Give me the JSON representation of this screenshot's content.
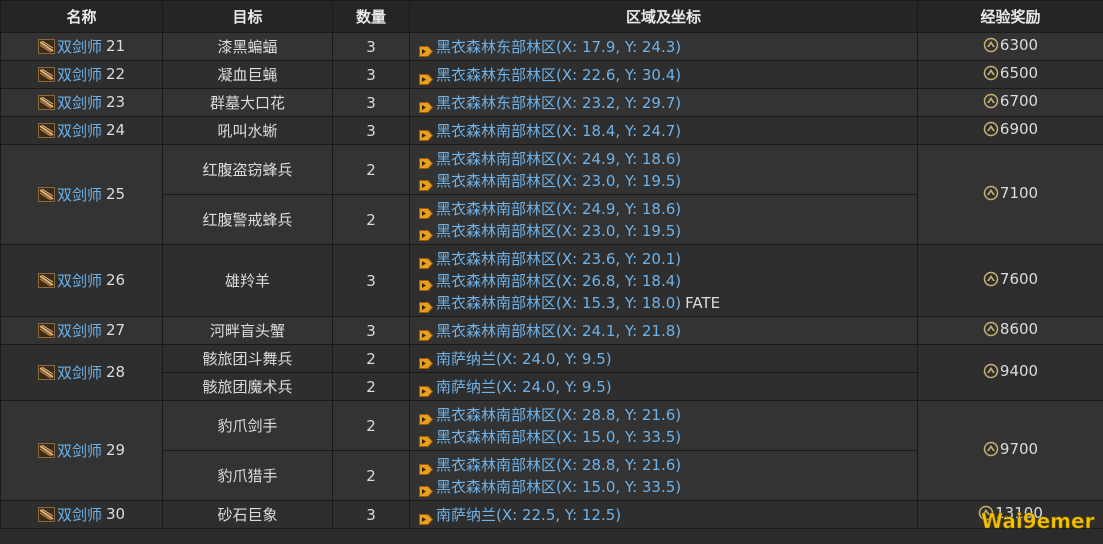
{
  "headers": {
    "name": "名称",
    "target": "目标",
    "qty": "数量",
    "zone": "区域及坐标",
    "exp": "经验奖励"
  },
  "rows": [
    {
      "job": "双剑师",
      "level": "21",
      "exp": "6300",
      "targets": [
        {
          "name": "漆黑蝙蝠",
          "qty": "3",
          "locs": [
            {
              "zone": "黑衣森林东部林区",
              "coord": "(X: 17.9, Y: 24.3)"
            }
          ]
        }
      ]
    },
    {
      "job": "双剑师",
      "level": "22",
      "exp": "6500",
      "targets": [
        {
          "name": "凝血巨蝇",
          "qty": "3",
          "locs": [
            {
              "zone": "黑衣森林东部林区",
              "coord": "(X: 22.6, Y: 30.4)"
            }
          ]
        }
      ]
    },
    {
      "job": "双剑师",
      "level": "23",
      "exp": "6700",
      "targets": [
        {
          "name": "群墓大口花",
          "qty": "3",
          "locs": [
            {
              "zone": "黑衣森林东部林区",
              "coord": "(X: 23.2, Y: 29.7)"
            }
          ]
        }
      ]
    },
    {
      "job": "双剑师",
      "level": "24",
      "exp": "6900",
      "targets": [
        {
          "name": "吼叫水蜥",
          "qty": "3",
          "locs": [
            {
              "zone": "黑衣森林南部林区",
              "coord": "(X: 18.4, Y: 24.7)"
            }
          ]
        }
      ]
    },
    {
      "job": "双剑师",
      "level": "25",
      "exp": "7100",
      "targets": [
        {
          "name": "红腹盗窃蜂兵",
          "qty": "2",
          "locs": [
            {
              "zone": "黑衣森林南部林区",
              "coord": "(X: 24.9, Y: 18.6)"
            },
            {
              "zone": "黑衣森林南部林区",
              "coord": "(X: 23.0, Y: 19.5)"
            }
          ]
        },
        {
          "name": "红腹警戒蜂兵",
          "qty": "2",
          "locs": [
            {
              "zone": "黑衣森林南部林区",
              "coord": "(X: 24.9, Y: 18.6)"
            },
            {
              "zone": "黑衣森林南部林区",
              "coord": "(X: 23.0, Y: 19.5)"
            }
          ]
        }
      ]
    },
    {
      "job": "双剑师",
      "level": "26",
      "exp": "7600",
      "targets": [
        {
          "name": "雄羚羊",
          "qty": "3",
          "locs": [
            {
              "zone": "黑衣森林南部林区",
              "coord": "(X: 23.6, Y: 20.1)"
            },
            {
              "zone": "黑衣森林南部林区",
              "coord": "(X: 26.8, Y: 18.4)"
            },
            {
              "zone": "黑衣森林南部林区",
              "coord": "(X: 15.3, Y: 18.0)",
              "extra": "FATE"
            }
          ]
        }
      ]
    },
    {
      "job": "双剑师",
      "level": "27",
      "exp": "8600",
      "targets": [
        {
          "name": "河畔盲头蟹",
          "qty": "3",
          "locs": [
            {
              "zone": "黑衣森林南部林区",
              "coord": "(X: 24.1, Y: 21.8)"
            }
          ]
        }
      ]
    },
    {
      "job": "双剑师",
      "level": "28",
      "exp": "9400",
      "targets": [
        {
          "name": "骸旅团斗舞兵",
          "qty": "2",
          "locs": [
            {
              "zone": "南萨纳兰",
              "coord": "(X: 24.0, Y: 9.5)"
            }
          ]
        },
        {
          "name": "骸旅团魔术兵",
          "qty": "2",
          "locs": [
            {
              "zone": "南萨纳兰",
              "coord": "(X: 24.0, Y: 9.5)"
            }
          ]
        }
      ]
    },
    {
      "job": "双剑师",
      "level": "29",
      "exp": "9700",
      "targets": [
        {
          "name": "豹爪剑手",
          "qty": "2",
          "locs": [
            {
              "zone": "黑衣森林南部林区",
              "coord": "(X: 28.8, Y: 21.6)"
            },
            {
              "zone": "黑衣森林南部林区",
              "coord": "(X: 15.0, Y: 33.5)"
            }
          ]
        },
        {
          "name": "豹爪猎手",
          "qty": "2",
          "locs": [
            {
              "zone": "黑衣森林南部林区",
              "coord": "(X: 28.8, Y: 21.6)"
            },
            {
              "zone": "黑衣森林南部林区",
              "coord": "(X: 15.0, Y: 33.5)"
            }
          ]
        }
      ]
    },
    {
      "job": "双剑师",
      "level": "30",
      "exp": "13100",
      "targets": [
        {
          "name": "砂石巨象",
          "qty": "3",
          "locs": [
            {
              "zone": "南萨纳兰",
              "coord": "(X: 22.5, Y: 12.5)"
            }
          ]
        }
      ]
    }
  ],
  "watermark": "Wai9emer",
  "icons": {
    "job": "dual-swords-icon",
    "marker": "map-marker-icon",
    "exp": "exp-crystal-icon"
  }
}
